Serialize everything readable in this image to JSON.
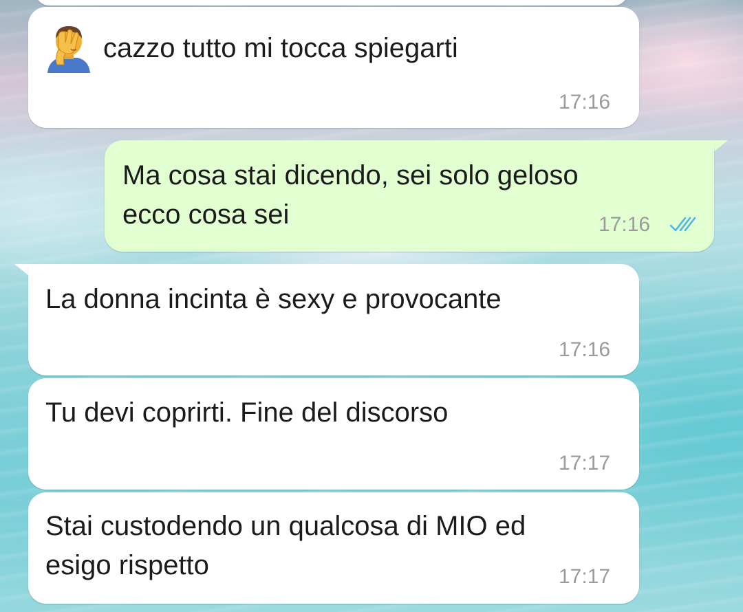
{
  "chat": {
    "messages": [
      {
        "direction": "incoming",
        "emoji": "person-facepalming",
        "text": "cazzo tutto mi tocca spiegarti",
        "time": "17:16"
      },
      {
        "direction": "outgoing",
        "lines": [
          "Ma cosa stai dicendo, sei solo geloso",
          "ecco cosa sei"
        ],
        "time": "17:16",
        "status": "read",
        "status_color": "#4fb3e8"
      },
      {
        "direction": "incoming",
        "text": "La donna incinta è sexy e provocante",
        "time": "17:16"
      },
      {
        "direction": "incoming",
        "text": "Tu devi coprirti. Fine del discorso",
        "time": "17:17"
      },
      {
        "direction": "incoming",
        "lines": [
          "Stai custodendo un qualcosa di MIO ed",
          "esigo rispetto"
        ],
        "time": "17:17"
      }
    ]
  },
  "colors": {
    "incoming_bubble": "#ffffff",
    "outgoing_bubble": "#e2ffd2",
    "text": "#1b1b1b",
    "timestamp": "#9b9b9b"
  }
}
